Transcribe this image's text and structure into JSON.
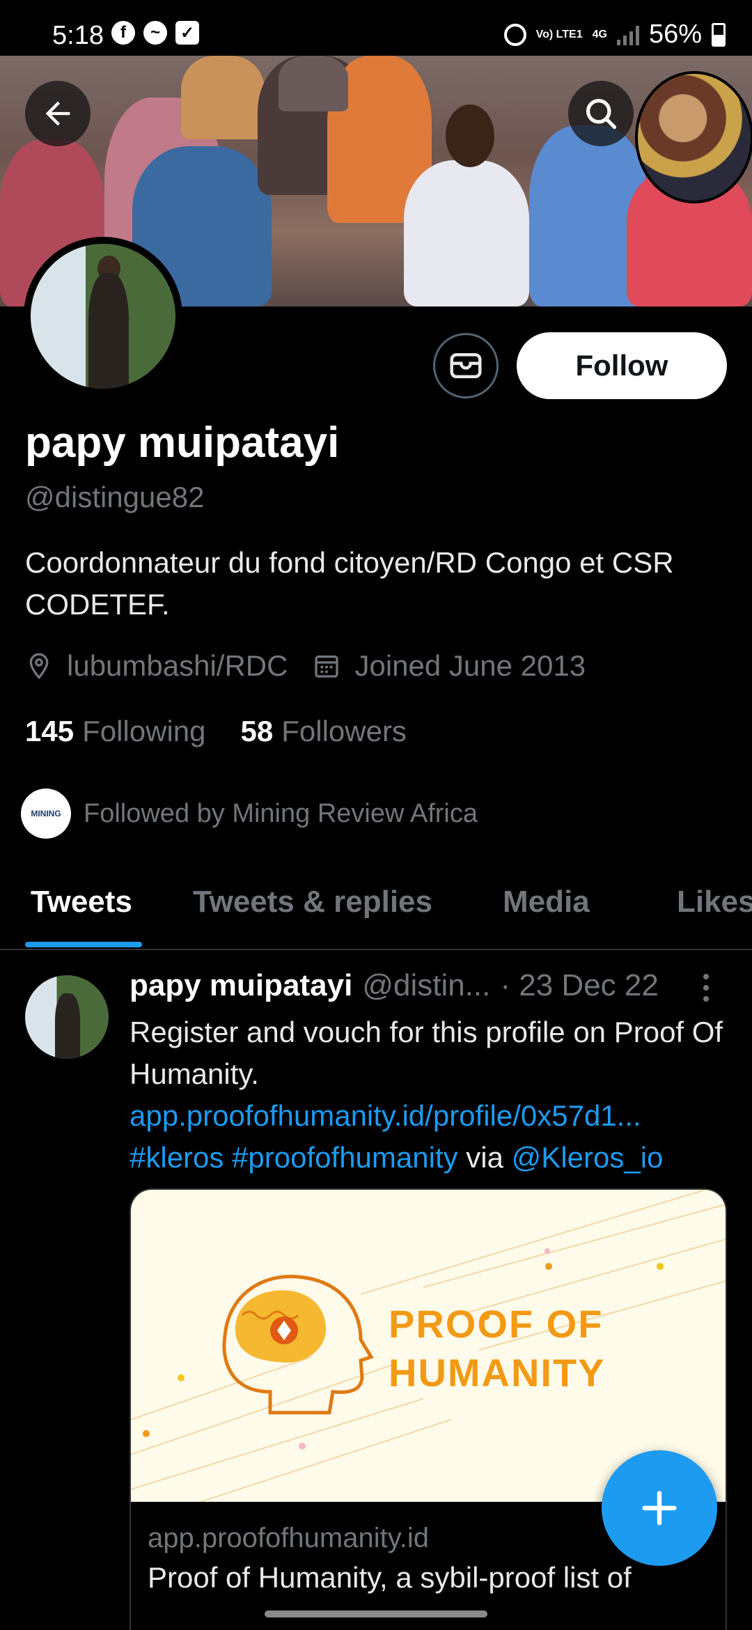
{
  "status_bar": {
    "time": "5:18",
    "network": "Vo) LTE1",
    "network_type": "4G",
    "battery": "56%"
  },
  "profile": {
    "name": "papy muipatayi",
    "handle": "@distingue82",
    "bio": "Coordonnateur du fond citoyen/RD Congo et CSR CODETEF.",
    "location": "lubumbashi/RDC",
    "joined": "Joined June 2013",
    "following_count": "145",
    "following_label": "Following",
    "followers_count": "58",
    "followers_label": "Followers",
    "followed_by": "Followed by Mining Review Africa",
    "followed_by_avatar_text": "MINING",
    "follow_button": "Follow"
  },
  "tabs": [
    {
      "label": "Tweets",
      "active": true
    },
    {
      "label": "Tweets & replies",
      "active": false
    },
    {
      "label": "Media",
      "active": false
    },
    {
      "label": "Likes",
      "active": false
    }
  ],
  "tweet": {
    "author_name": "papy muipatayi",
    "author_handle": "@distin...",
    "date": "· 23 Dec 22",
    "text_plain": "Register and vouch for this profile on Proof Of Humanity.",
    "link_url": "app.proofofhumanity.id/profile/0x57d1...",
    "hashtag1": "#kleros",
    "hashtag2": "#proofofhumanity",
    "via_text": "via",
    "mention": "@Kleros_io",
    "card": {
      "image_text_line1": "PROOF OF",
      "image_text_line2": "HUMANITY",
      "domain": "app.proofofhumanity.id",
      "title": "Proof of Humanity, a sybil-proof list of"
    }
  },
  "colors": {
    "accent": "#1d9bf0",
    "background": "#000000",
    "muted_text": "#71767b",
    "brand_orange": "#f29a14"
  }
}
